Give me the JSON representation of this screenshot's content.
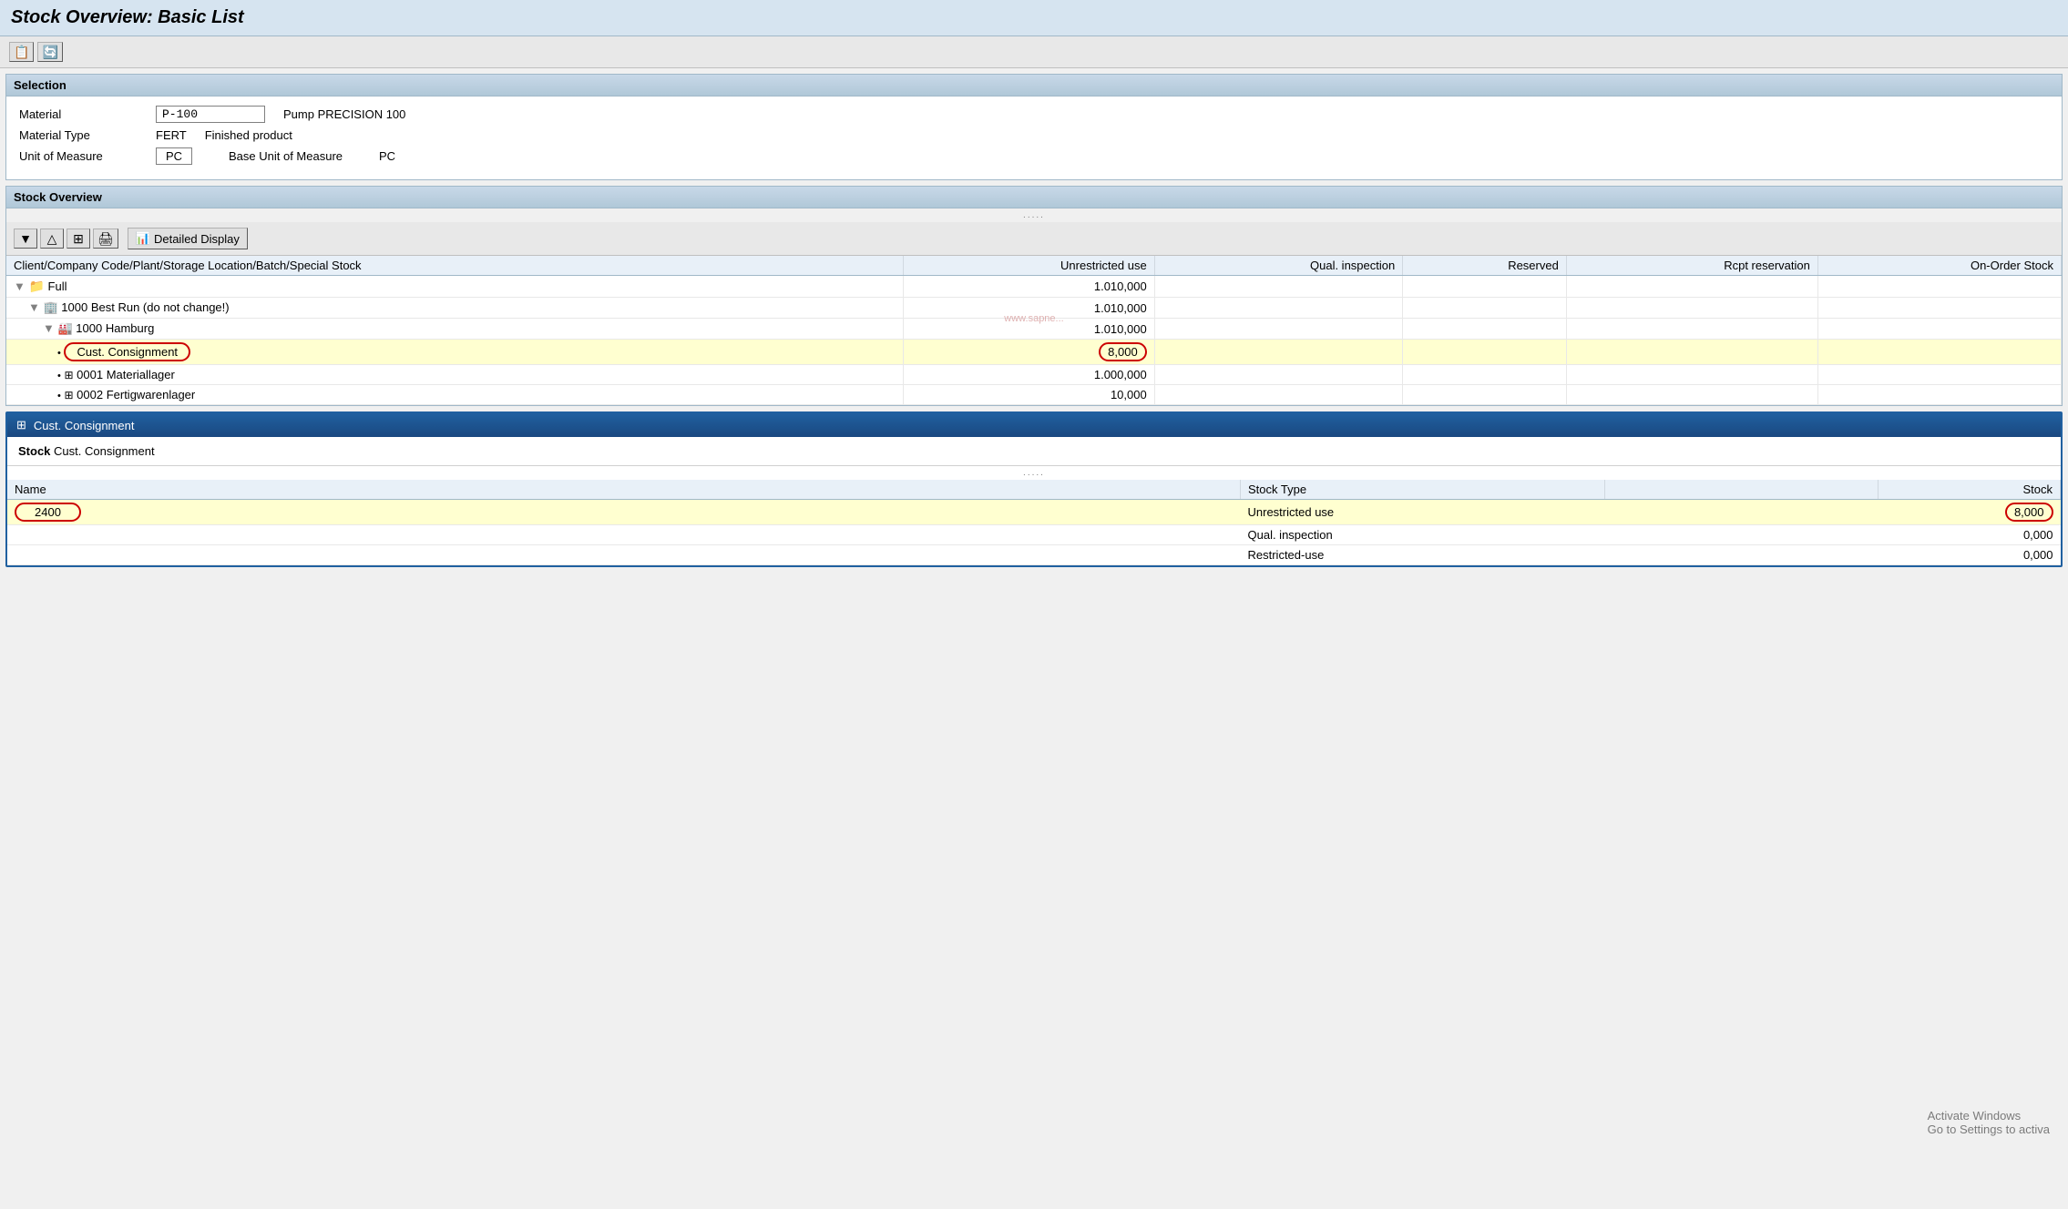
{
  "title": "Stock Overview: Basic List",
  "toolbar_top": {
    "btn1_icon": "📋",
    "btn2_icon": "🔄"
  },
  "selection": {
    "header": "Selection",
    "fields": [
      {
        "label": "Material",
        "value": "P-100",
        "desc": "Pump PRECISION 100",
        "has_box": true
      },
      {
        "label": "Material Type",
        "value": "FERT",
        "desc": "Finished product",
        "has_box": false
      },
      {
        "label": "Unit of Measure",
        "value": "PC",
        "desc": "",
        "has_box": true,
        "extra_label": "Base Unit of Measure",
        "extra_value": "PC"
      }
    ]
  },
  "stock_overview": {
    "header": "Stock Overview",
    "drag_dots": ".....",
    "detailed_display_label": "Detailed Display",
    "table": {
      "columns": [
        "Client/Company Code/Plant/Storage Location/Batch/Special Stock",
        "Unrestricted use",
        "Qual. inspection",
        "Reserved",
        "Rcpt reservation",
        "On-Order Stock"
      ],
      "rows": [
        {
          "indent": 0,
          "icon": "arrow",
          "label": "Full",
          "unrestricted": "1.010,000",
          "highlighted": false
        },
        {
          "indent": 1,
          "icon": "company",
          "label": "1000 Best Run (do not change!)",
          "unrestricted": "1.010,000",
          "highlighted": false
        },
        {
          "indent": 2,
          "icon": "plant",
          "label": "1000 Hamburg",
          "unrestricted": "1.010,000",
          "highlighted": false
        },
        {
          "indent": 3,
          "icon": "dot",
          "label": "Cust. Consignment",
          "unrestricted": "8,000",
          "highlighted": true
        },
        {
          "indent": 3,
          "icon": "storage",
          "label": "0001 Materiallager",
          "unrestricted": "1.000,000",
          "highlighted": false
        },
        {
          "indent": 3,
          "icon": "storage",
          "label": "0002 Fertigwarenlager",
          "unrestricted": "10,000",
          "highlighted": false
        }
      ]
    }
  },
  "detail_panel": {
    "header_icon": "⊞",
    "header_label": "Cust. Consignment",
    "stock_label": "Stock",
    "stock_value": "Cust. Consignment",
    "drag_dots": ".....",
    "table": {
      "columns": [
        "Name",
        "Stock Type",
        "",
        "Stock"
      ],
      "rows": [
        {
          "name": "2400",
          "stock_type": "Unrestricted use",
          "stock": "8,000",
          "highlighted": true
        },
        {
          "name": "",
          "stock_type": "Qual. inspection",
          "stock": "0,000",
          "highlighted": false
        },
        {
          "name": "",
          "stock_type": "Restricted-use",
          "stock": "0,000",
          "highlighted": false
        }
      ]
    }
  },
  "watermark": "www.sapne...",
  "win_activate_line1": "Activate Windows",
  "win_activate_line2": "Go to Settings to activa"
}
